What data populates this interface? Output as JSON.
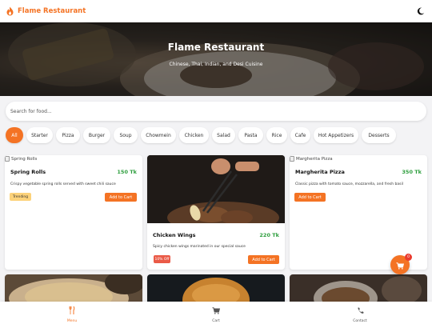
{
  "header": {
    "brand": "Flame Restaurant",
    "theme_icon": "moon-icon",
    "accent": "#f47324"
  },
  "hero": {
    "title": "Flame Restaurant",
    "subtitle": "Chinese, Thai, Indian, and Desi Cuisine"
  },
  "search": {
    "placeholder": "Search for food..."
  },
  "categories": [
    "All",
    "Starter",
    "Pizza",
    "Burger",
    "Soup",
    "Chowmein",
    "Chicken",
    "Salad",
    "Pasta",
    "Rice",
    "Cafe",
    "Hot Appetizers",
    "Desserts"
  ],
  "items": [
    {
      "image_alt": "Spring Rolls",
      "name": "Spring Rolls",
      "price": "150 Tk",
      "description": "Crispy vegetable spring rolls served with sweet chili sauce",
      "badge": "Trending",
      "button": "Add to Cart"
    },
    {
      "name": "Chicken Wings",
      "price": "220 Tk",
      "description": "Spicy chicken wings marinated in our special sauce",
      "badge": "10% Off",
      "button": "Add to Cart"
    },
    {
      "image_alt": "Margherita Pizza",
      "name": "Margherita Pizza",
      "price": "350 Tk",
      "description": "Classic pizza with tomato sauce, mozzarella, and fresh basil",
      "button": "Add to Cart"
    }
  ],
  "cart_badge": "0",
  "bottom_nav": [
    {
      "label": "Menu",
      "icon": "fork-knife-icon"
    },
    {
      "label": "Cart",
      "icon": "cart-icon"
    },
    {
      "label": "Contact",
      "icon": "phone-icon"
    }
  ]
}
